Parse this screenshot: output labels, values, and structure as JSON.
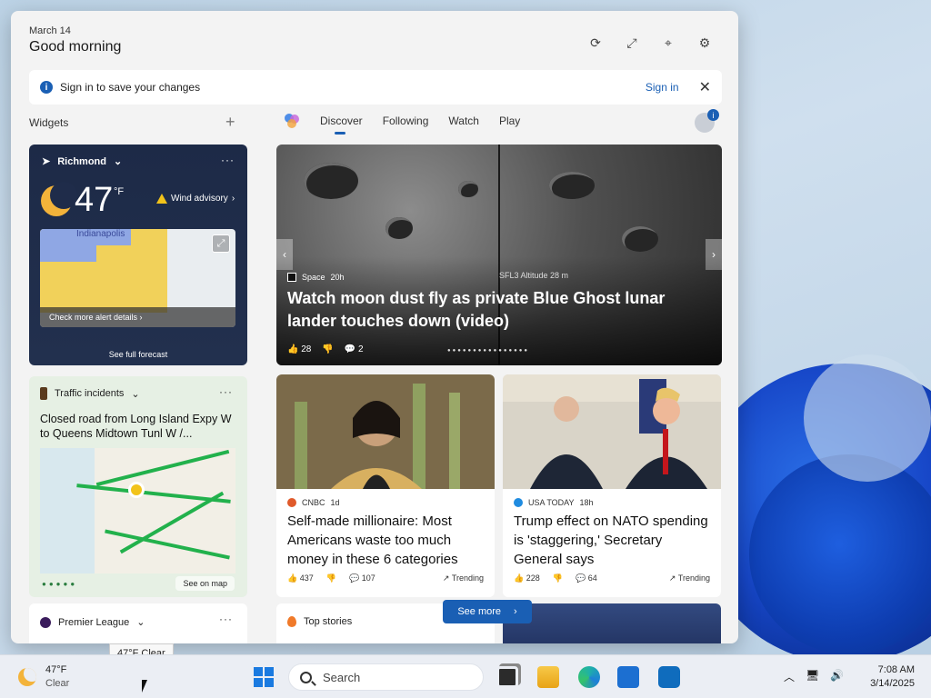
{
  "panel": {
    "date": "March 14",
    "greeting": "Good morning",
    "header_icons": [
      "refresh-icon",
      "expand-icon",
      "pin-icon",
      "gear-icon"
    ]
  },
  "signin_bar": {
    "text": "Sign in to save your changes",
    "link": "Sign in"
  },
  "widgets": {
    "label": "Widgets",
    "add": "+"
  },
  "nav": {
    "tabs": [
      "Discover",
      "Following",
      "Watch",
      "Play"
    ],
    "active": "Discover",
    "profile_badge": "i"
  },
  "weather": {
    "location": "Richmond",
    "temp": "47",
    "unit": "°F",
    "advisory": "Wind advisory",
    "map_city": "Indianapolis",
    "map_cta": "Check more alert details",
    "forecast": "See full forecast"
  },
  "traffic": {
    "label": "Traffic incidents",
    "title": "Closed road from Long Island Expy W to Queens Midtown Tunl W /...",
    "see_map": "See on map"
  },
  "premier": {
    "label": "Premier League"
  },
  "hero": {
    "source": "Space",
    "age": "20h",
    "altitude": "SFL3 Altitude 28 m",
    "title": "Watch moon dust fly as private Blue Ghost lunar lander touches down (video)",
    "likes": "28",
    "comments": "2"
  },
  "cards": [
    {
      "source": "CNBC",
      "age": "1d",
      "title": "Self-made millionaire: Most Americans waste too much money in these 6 categories",
      "likes": "437",
      "comments": "107",
      "trend": "Trending",
      "logo_color": "#e05a2b"
    },
    {
      "source": "USA TODAY",
      "age": "18h",
      "title": "Trump effect on NATO spending is 'staggering,' Secretary General says",
      "likes": "228",
      "comments": "64",
      "trend": "Trending",
      "logo_color": "#1f8be0"
    }
  ],
  "top_stories": {
    "label": "Top stories",
    "see_more": "See more"
  },
  "tooltip": "47°F Clear",
  "taskbar": {
    "weather_temp": "47°F",
    "weather_cond": "Clear",
    "search_placeholder": "Search",
    "time": "7:08 AM",
    "date": "3/14/2025",
    "apps": [
      "task-view-icon",
      "file-explorer-icon",
      "edge-icon",
      "store-icon",
      "outlook-icon"
    ]
  }
}
